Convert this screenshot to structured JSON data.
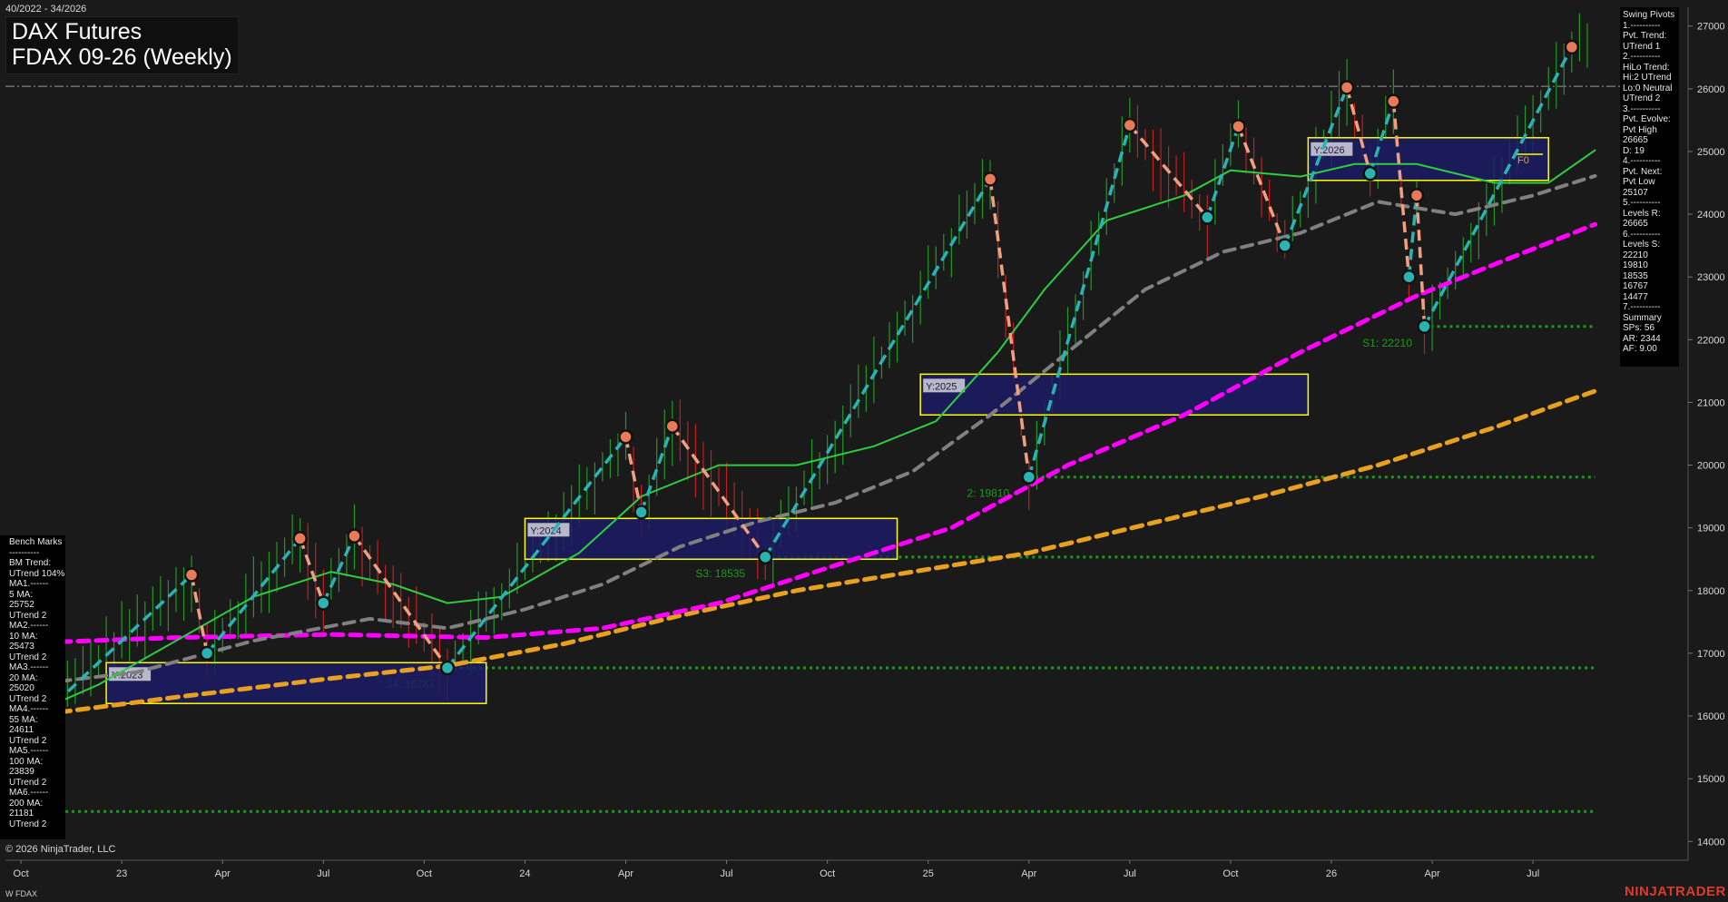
{
  "header": {
    "date_range": "40/2022 - 34/2026",
    "title_line1": "DAX Futures",
    "title_line2": "FDAX 09-26 (Weekly)"
  },
  "swing_panel_lines": [
    "Swing Pivots",
    "1.----------",
    "Pvt. Trend:",
    "UTrend 1",
    "2.----------",
    "HiLo Trend:",
    "Hi:2 UTrend",
    "Lo:0 Neutral",
    "UTrend 2",
    "3.----------",
    "Pvt. Evolve:",
    "Pvt High",
    "26665",
    "D: 19",
    "4.----------",
    "Pvt. Next:",
    "Pvt Low",
    "25107",
    "5.----------",
    "Levels R:",
    "26665",
    "6.----------",
    "Levels S:",
    "22210",
    "19810",
    "18535",
    "16767",
    "14477",
    "7.----------",
    "Summary",
    "SPs: 56",
    "AR: 2344",
    "AF: 9.00"
  ],
  "bench_panel_lines": [
    "Bench Marks",
    "----------",
    "BM Trend:",
    "UTrend 104%",
    "MA1.------",
    "5 MA:",
    "25752",
    "UTrend 2",
    "MA2.------",
    "10 MA:",
    "25473",
    "UTrend 2",
    "MA3.------",
    "20 MA:",
    "25020",
    "UTrend 2",
    "MA4.------",
    "55 MA:",
    "24611",
    "UTrend 2",
    "MA5.------",
    "100 MA:",
    "23839",
    "UTrend 2",
    "MA6.------",
    "200 MA:",
    "21181",
    "UTrend 2"
  ],
  "footer": {
    "copyright": "© 2026 NinjaTrader, LLC",
    "symbol": "W FDAX",
    "brand": "NINJATRADER"
  },
  "colors": {
    "background": "#1a1a1a",
    "up_leg": "#2ab3b3",
    "down_leg": "#f0a080",
    "ma_green": "#2ecc40",
    "ma_gray": "#808080",
    "ma_magenta": "#ff00ff",
    "ma_orange": "#e8a020",
    "support": "#1a9a1a",
    "year_box_fill": "#1c1c66",
    "year_box_border": "#ffff00"
  },
  "chart_data": {
    "type": "line",
    "y_ticks": [
      14000,
      15000,
      16000,
      17000,
      18000,
      19000,
      20000,
      21000,
      22000,
      23000,
      24000,
      25000,
      26000,
      27000
    ],
    "ylim": [
      13700,
      27300
    ],
    "x_ticks": [
      {
        "t": 0,
        "label": "Oct"
      },
      {
        "t": 13,
        "label": "23"
      },
      {
        "t": 26,
        "label": "Apr"
      },
      {
        "t": 39,
        "label": "Jul"
      },
      {
        "t": 52,
        "label": "Oct"
      },
      {
        "t": 65,
        "label": "24"
      },
      {
        "t": 78,
        "label": "Apr"
      },
      {
        "t": 91,
        "label": "Jul"
      },
      {
        "t": 104,
        "label": "Oct"
      },
      {
        "t": 117,
        "label": "25"
      },
      {
        "t": 130,
        "label": "Apr"
      },
      {
        "t": 143,
        "label": "Jul"
      },
      {
        "t": 156,
        "label": "Oct"
      },
      {
        "t": 169,
        "label": "26"
      },
      {
        "t": 182,
        "label": "Apr"
      },
      {
        "t": 195,
        "label": "Jul"
      }
    ],
    "xlim": [
      -2,
      215
    ],
    "resistance_line": 26040,
    "swing_points": [
      {
        "t": -2,
        "y": 15450,
        "kind": "low"
      },
      {
        "t": 22,
        "y": 18250,
        "kind": "high"
      },
      {
        "t": 24,
        "y": 17000,
        "kind": "low"
      },
      {
        "t": 36,
        "y": 18830,
        "kind": "high"
      },
      {
        "t": 39,
        "y": 17800,
        "kind": "low"
      },
      {
        "t": 43,
        "y": 18870,
        "kind": "high"
      },
      {
        "t": 55,
        "y": 16767,
        "kind": "low"
      },
      {
        "t": 78,
        "y": 20450,
        "kind": "high"
      },
      {
        "t": 80,
        "y": 19250,
        "kind": "low"
      },
      {
        "t": 84,
        "y": 20620,
        "kind": "high"
      },
      {
        "t": 96,
        "y": 18535,
        "kind": "low"
      },
      {
        "t": 125,
        "y": 24560,
        "kind": "high"
      },
      {
        "t": 130,
        "y": 19810,
        "kind": "low"
      },
      {
        "t": 143,
        "y": 25420,
        "kind": "high"
      },
      {
        "t": 153,
        "y": 23950,
        "kind": "low"
      },
      {
        "t": 157,
        "y": 25400,
        "kind": "high"
      },
      {
        "t": 163,
        "y": 23500,
        "kind": "low"
      },
      {
        "t": 171,
        "y": 26020,
        "kind": "high"
      },
      {
        "t": 174,
        "y": 24650,
        "kind": "low"
      },
      {
        "t": 177,
        "y": 25800,
        "kind": "high"
      },
      {
        "t": 179,
        "y": 23000,
        "kind": "low"
      },
      {
        "t": 180,
        "y": 24300,
        "kind": "high"
      },
      {
        "t": 181,
        "y": 22210,
        "kind": "low"
      },
      {
        "t": 200,
        "y": 26665,
        "kind": "high"
      }
    ],
    "support_levels": [
      {
        "value": 22210,
        "label": "S1: 22210",
        "t_start": 181,
        "label_t": 173
      },
      {
        "value": 19810,
        "label": "2: 19810",
        "t_start": 130,
        "label_t": 122
      },
      {
        "value": 18535,
        "label": "S3: 18535",
        "t_start": 96,
        "label_t": 87
      },
      {
        "value": 16767,
        "label": "S4: 16767",
        "t_start": 55,
        "label_t": 47
      },
      {
        "value": 14477,
        "label": "",
        "t_start": 0,
        "label_t": 0
      }
    ],
    "year_boxes": [
      {
        "label": "Y:2023",
        "t0": 11,
        "t1": 60,
        "y_low": 16200,
        "y_high": 16850
      },
      {
        "label": "Y:2024",
        "t0": 65,
        "t1": 113,
        "y_low": 18500,
        "y_high": 19150
      },
      {
        "label": "Y:2025",
        "t0": 116,
        "t1": 166,
        "y_low": 20800,
        "y_high": 21450
      },
      {
        "label": "Y:2026",
        "t0": 166,
        "t1": 197,
        "y_low": 24540,
        "y_high": 25220
      }
    ],
    "fib_label": {
      "label": "F0",
      "t": 193,
      "y": 24870
    },
    "moving_averages": [
      {
        "name": "200 MA",
        "color": "#e8a020",
        "dash": true,
        "width": 5,
        "points": [
          [
            -2,
            15950
          ],
          [
            20,
            16300
          ],
          [
            40,
            16600
          ],
          [
            55,
            16800
          ],
          [
            70,
            17150
          ],
          [
            85,
            17600
          ],
          [
            100,
            18000
          ],
          [
            115,
            18300
          ],
          [
            130,
            18600
          ],
          [
            145,
            19050
          ],
          [
            160,
            19500
          ],
          [
            175,
            20000
          ],
          [
            190,
            20600
          ],
          [
            200,
            21050
          ],
          [
            203,
            21181
          ]
        ]
      },
      {
        "name": "100 MA",
        "color": "#ff00ff",
        "dash": true,
        "width": 5,
        "points": [
          [
            -2,
            17150
          ],
          [
            20,
            17250
          ],
          [
            40,
            17300
          ],
          [
            60,
            17250
          ],
          [
            75,
            17400
          ],
          [
            90,
            17800
          ],
          [
            105,
            18400
          ],
          [
            120,
            19000
          ],
          [
            135,
            20000
          ],
          [
            150,
            20800
          ],
          [
            165,
            21800
          ],
          [
            180,
            22700
          ],
          [
            190,
            23200
          ],
          [
            203,
            23839
          ]
        ]
      },
      {
        "name": "55 MA",
        "color": "#808080",
        "dash": true,
        "width": 4,
        "points": [
          [
            -2,
            16450
          ],
          [
            15,
            16700
          ],
          [
            30,
            17200
          ],
          [
            45,
            17550
          ],
          [
            55,
            17400
          ],
          [
            65,
            17700
          ],
          [
            75,
            18100
          ],
          [
            85,
            18700
          ],
          [
            95,
            19100
          ],
          [
            105,
            19400
          ],
          [
            115,
            19900
          ],
          [
            125,
            20800
          ],
          [
            135,
            21800
          ],
          [
            145,
            22800
          ],
          [
            155,
            23400
          ],
          [
            165,
            23700
          ],
          [
            175,
            24200
          ],
          [
            185,
            24000
          ],
          [
            195,
            24300
          ],
          [
            203,
            24611
          ]
        ]
      },
      {
        "name": "20 MA",
        "color": "#2ecc40",
        "dash": false,
        "width": 2,
        "points": [
          [
            -2,
            15850
          ],
          [
            10,
            16500
          ],
          [
            20,
            17200
          ],
          [
            30,
            17900
          ],
          [
            40,
            18300
          ],
          [
            48,
            18100
          ],
          [
            55,
            17800
          ],
          [
            62,
            17900
          ],
          [
            72,
            18600
          ],
          [
            80,
            19500
          ],
          [
            90,
            20000
          ],
          [
            100,
            20000
          ],
          [
            110,
            20300
          ],
          [
            118,
            20700
          ],
          [
            126,
            21800
          ],
          [
            132,
            22800
          ],
          [
            140,
            23900
          ],
          [
            150,
            24300
          ],
          [
            156,
            24700
          ],
          [
            165,
            24600
          ],
          [
            172,
            24800
          ],
          [
            180,
            24800
          ],
          [
            190,
            24500
          ],
          [
            197,
            24500
          ],
          [
            203,
            25020
          ]
        ]
      }
    ],
    "ohlc_sample_lines": "derived"
  }
}
